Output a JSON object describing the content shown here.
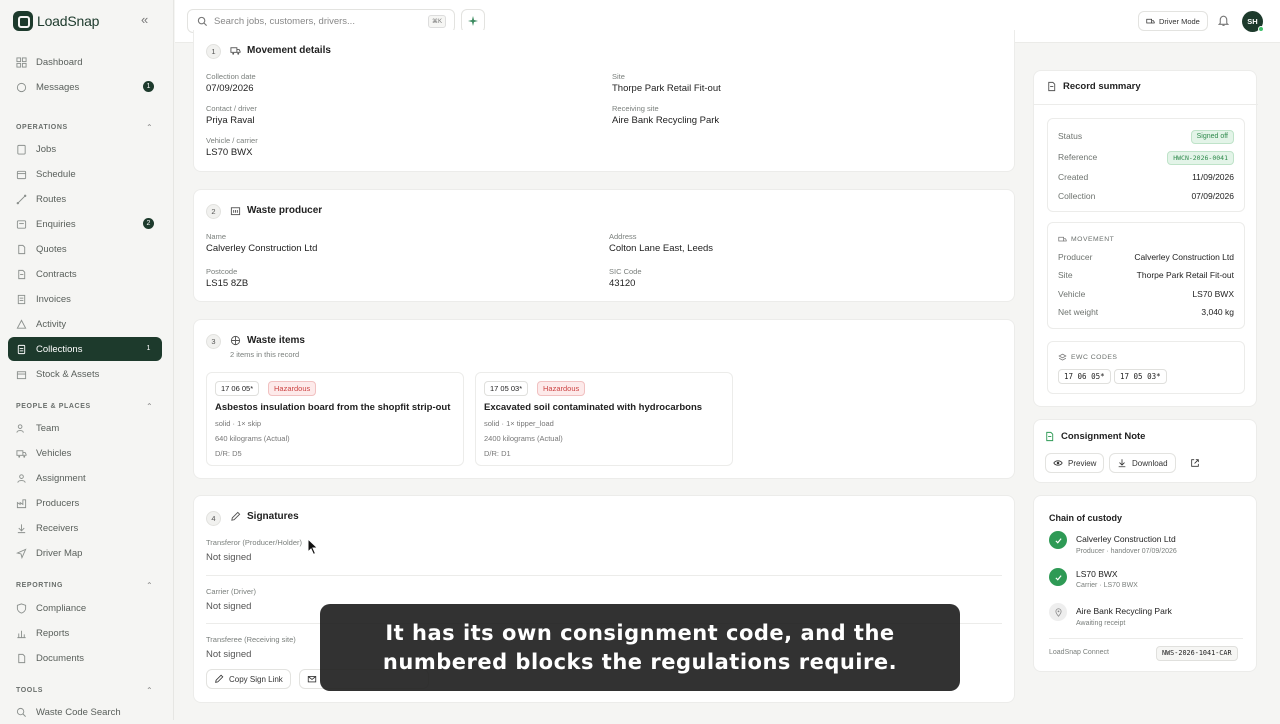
{
  "app": {
    "name": "LoadSnap"
  },
  "sidebar": {
    "items_top": [
      {
        "label": "Dashboard",
        "icon": "dashboard-icon"
      },
      {
        "label": "Messages",
        "icon": "message-icon",
        "badge": "1"
      }
    ],
    "sections": [
      {
        "title": "OPERATIONS",
        "items": [
          {
            "label": "Jobs"
          },
          {
            "label": "Schedule"
          },
          {
            "label": "Routes"
          },
          {
            "label": "Enquiries",
            "badge": "2"
          },
          {
            "label": "Quotes"
          },
          {
            "label": "Contracts"
          },
          {
            "label": "Invoices"
          },
          {
            "label": "Activity"
          },
          {
            "label": "Collections",
            "badge": "1",
            "active": true
          },
          {
            "label": "Stock & Assets"
          }
        ]
      },
      {
        "title": "PEOPLE & PLACES",
        "items": [
          {
            "label": "Team"
          },
          {
            "label": "Vehicles"
          },
          {
            "label": "Assignment"
          },
          {
            "label": "Producers"
          },
          {
            "label": "Receivers"
          },
          {
            "label": "Driver Map"
          }
        ]
      },
      {
        "title": "REPORTING",
        "items": [
          {
            "label": "Compliance"
          },
          {
            "label": "Reports"
          },
          {
            "label": "Documents"
          }
        ]
      },
      {
        "title": "TOOLS",
        "items": [
          {
            "label": "Waste Code Search"
          }
        ]
      }
    ]
  },
  "topbar": {
    "search_placeholder": "Search jobs, customers, drivers...",
    "search_kbd": "⌘K",
    "driver_mode": "Driver Mode",
    "avatar_initials": "SH"
  },
  "movement": {
    "num": "1",
    "title": "Movement details",
    "collection_date_label": "Collection date",
    "collection_date": "07/09/2026",
    "site_label": "Site",
    "site": "Thorpe Park Retail Fit-out",
    "contact_label": "Contact / driver",
    "contact": "Priya Raval",
    "receiving_label": "Receiving site",
    "receiving": "Aire Bank Recycling Park",
    "vehicle_label": "Vehicle / carrier",
    "vehicle": "LS70 BWX"
  },
  "producer": {
    "num": "2",
    "title": "Waste producer",
    "name_label": "Name",
    "name": "Calverley Construction Ltd",
    "address_label": "Address",
    "address": "Colton Lane East, Leeds",
    "postcode_label": "Postcode",
    "postcode": "LS15 8ZB",
    "sic_label": "SIC Code",
    "sic": "43120"
  },
  "waste_items": {
    "num": "3",
    "title": "Waste items",
    "subtitle": "2 items in this record",
    "items": [
      {
        "code": "17 06 05*",
        "hazard": "Hazardous",
        "title": "Asbestos insulation board from the shopfit strip-out",
        "form": "solid · 1× skip",
        "weight": "640 kilograms (Actual)",
        "dr": "D/R: D5"
      },
      {
        "code": "17 05 03*",
        "hazard": "Hazardous",
        "title": "Excavated soil contaminated with hydrocarbons",
        "form": "solid · 1× tipper_load",
        "weight": "2400 kilograms (Actual)",
        "dr": "D/R: D1"
      }
    ]
  },
  "signatures": {
    "num": "4",
    "title": "Signatures",
    "transferor_label": "Transferor (Producer/Holder)",
    "transferor_status": "Not signed",
    "carrier_label": "Carrier (Driver)",
    "carrier_status": "Not signed",
    "transferee_label": "Transferee (Receiving site)",
    "transferee_status": "Not signed",
    "copy_link": "Copy Sign Link"
  },
  "record_summary": {
    "title": "Record summary",
    "status_label": "Status",
    "status": "Signed off",
    "reference_label": "Reference",
    "reference": "HWCN-2026-0041",
    "created_label": "Created",
    "created": "11/09/2026",
    "collection_label": "Collection",
    "collection": "07/09/2026",
    "movement_head": "MOVEMENT",
    "producer_label": "Producer",
    "producer": "Calverley Construction Ltd",
    "site_label": "Site",
    "site": "Thorpe Park Retail Fit-out",
    "vehicle_label": "Vehicle",
    "vehicle": "LS70 BWX",
    "weight_label": "Net weight",
    "weight": "3,040 kg",
    "ewc_head": "EWC CODES",
    "ewc_codes": [
      "17 06 05*",
      "17 05 03*"
    ]
  },
  "consignment": {
    "title": "Consignment Note",
    "preview": "Preview",
    "download": "Download"
  },
  "custody": {
    "title": "Chain of custody",
    "steps": [
      {
        "title": "Calverley Construction Ltd",
        "sub": "Producer · handover 07/09/2026",
        "state": "done"
      },
      {
        "title": "LS70 BWX",
        "sub": "Carrier · LS70 BWX",
        "state": "done"
      },
      {
        "title": "Aire Bank Recycling Park",
        "sub": "Awaiting receipt",
        "state": "pending"
      }
    ],
    "connect_label": "LoadSnap Connect",
    "connect_code": "NWS-2026-1041-CAR"
  },
  "caption": {
    "line1": "It has its own consignment code, and the",
    "line2": "numbered blocks the regulations require."
  }
}
